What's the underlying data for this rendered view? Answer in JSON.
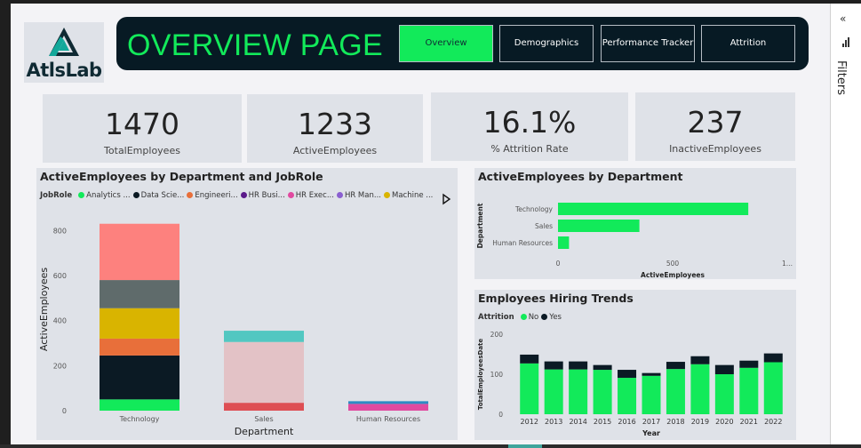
{
  "logo": {
    "wordmark": "AtlsLab",
    "colors": {
      "dark": "#0f2a33",
      "accent": "#12a89a"
    }
  },
  "header": {
    "title": "OVERVIEW PAGE",
    "nav": [
      {
        "label": "Overview",
        "active": true
      },
      {
        "label": "Demographics",
        "active": false
      },
      {
        "label": "Performance Tracker",
        "active": false
      },
      {
        "label": "Attrition",
        "active": false
      }
    ]
  },
  "kpis": [
    {
      "value": "1470",
      "label": "TotalEmployees"
    },
    {
      "value": "1233",
      "label": "ActiveEmployees"
    },
    {
      "value": "16.1%",
      "label": "% Attrition Rate"
    },
    {
      "value": "237",
      "label": "InactiveEmployees"
    }
  ],
  "filters_pane": {
    "label": "Filters",
    "icon": "collapse-chevron-icon"
  },
  "colors": {
    "accent": "#12ea5a",
    "header_bg": "#071a24",
    "panel_bg": "#dfe2e8"
  },
  "chart_data": [
    {
      "type": "bar",
      "stacked": true,
      "title": "ActiveEmployees by Department and JobRole",
      "legend_title": "JobRole",
      "legend_overflow_icon": "play-arrow-icon",
      "xlabel": "Department",
      "ylabel": "ActiveEmployees",
      "ylim": [
        0,
        900
      ],
      "yticks": [
        0,
        200,
        400,
        600,
        800
      ],
      "categories": [
        "Technology",
        "Sales",
        "Human Resources"
      ],
      "series": [
        {
          "name": "Analytics ...",
          "color": "#12ea5a",
          "values": [
            50,
            0,
            0
          ]
        },
        {
          "name": "Data Scie...",
          "color": "#0b1a24",
          "values": [
            195,
            0,
            0
          ]
        },
        {
          "name": "Engineeri...",
          "color": "#e86f3a",
          "values": [
            75,
            0,
            0
          ]
        },
        {
          "name": "HR Busi...",
          "color": "#5b1a8a",
          "values": [
            0,
            0,
            0
          ]
        },
        {
          "name": "HR Exec...",
          "color": "#e14aa0",
          "values": [
            0,
            0,
            30
          ]
        },
        {
          "name": "HR Man...",
          "color": "#8a5fd0",
          "values": [
            0,
            0,
            0
          ]
        },
        {
          "name": "Machine ...",
          "color": "#d9b400",
          "values": [
            135,
            0,
            0
          ]
        },
        {
          "name": "",
          "color": "#5f6b6b",
          "values": [
            125,
            0,
            0
          ]
        },
        {
          "name": "",
          "color": "#fd817e",
          "values": [
            250,
            0,
            0
          ]
        },
        {
          "name": "",
          "color": "#de4e53",
          "values": [
            0,
            35,
            0
          ]
        },
        {
          "name": "",
          "color": "#e3c2c6",
          "values": [
            0,
            270,
            0
          ]
        },
        {
          "name": "",
          "color": "#52c7c1",
          "values": [
            0,
            50,
            0
          ]
        },
        {
          "name": "",
          "color": "#2f8ac4",
          "values": [
            0,
            0,
            12
          ]
        }
      ]
    },
    {
      "type": "bar",
      "orientation": "horizontal",
      "title": "ActiveEmployees by Department",
      "xlabel": "ActiveEmployees",
      "ylabel": "Department",
      "xlim": [
        0,
        1000
      ],
      "xticks": [
        "0",
        "500",
        "1..."
      ],
      "categories": [
        "Technology",
        "Sales",
        "Human Resources"
      ],
      "values": [
        830,
        355,
        48
      ],
      "color": "#12ea5a"
    },
    {
      "type": "bar",
      "stacked": true,
      "title": "Employees Hiring Trends",
      "legend_title": "Attrition",
      "xlabel": "Year",
      "ylabel": "TotalEmployeesDate",
      "ylim": [
        0,
        200
      ],
      "yticks": [
        0,
        100,
        200
      ],
      "categories": [
        "2012",
        "2013",
        "2014",
        "2015",
        "2016",
        "2017",
        "2018",
        "2019",
        "2020",
        "2021",
        "2022"
      ],
      "series": [
        {
          "name": "No",
          "color": "#12ea5a",
          "values": [
            127,
            112,
            112,
            111,
            91,
            96,
            113,
            125,
            100,
            116,
            130
          ]
        },
        {
          "name": "Yes",
          "color": "#0b1a24",
          "values": [
            22,
            20,
            20,
            12,
            20,
            7,
            18,
            20,
            23,
            18,
            22
          ]
        }
      ]
    }
  ]
}
